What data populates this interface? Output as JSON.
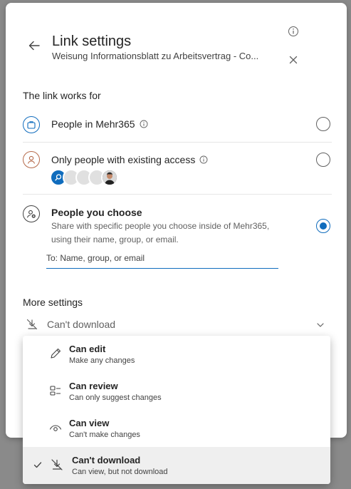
{
  "header": {
    "title": "Link settings",
    "subtitle": "Weisung Informationsblatt zu Arbeitsvertrag - Co..."
  },
  "link_works_for": {
    "label": "The link works for",
    "options": [
      {
        "label": "People in Mehr365",
        "selected": false
      },
      {
        "label": "Only people with existing access",
        "selected": false
      },
      {
        "label": "People you choose",
        "description": "Share with specific people you choose inside of Mehr365, using their name, group, or email.",
        "selected": true
      }
    ],
    "to_placeholder": "To: Name, group, or email"
  },
  "more_settings": {
    "label": "More settings",
    "download_value": "Can't download"
  },
  "dropdown": {
    "items": [
      {
        "title": "Can edit",
        "desc": "Make any changes",
        "icon": "pencil-icon",
        "selected": false
      },
      {
        "title": "Can review",
        "desc": "Can only suggest changes",
        "icon": "review-icon",
        "selected": false
      },
      {
        "title": "Can view",
        "desc": "Can't make changes",
        "icon": "eye-icon",
        "selected": false
      },
      {
        "title": "Can't download",
        "desc": "Can view, but not download",
        "icon": "no-download-icon",
        "selected": true
      }
    ]
  },
  "colors": {
    "accent": "#0f6cbd",
    "overlay": "#8a8a8a"
  }
}
